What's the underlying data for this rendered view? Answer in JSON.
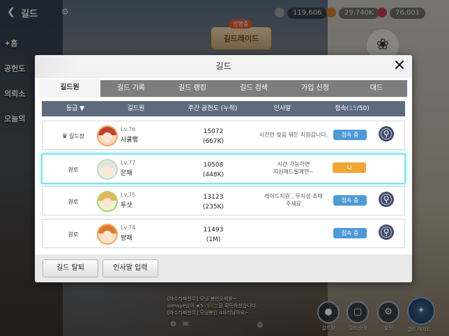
{
  "topbar": {
    "back_icon": "chevron-left-icon",
    "title": "길드",
    "currencies": [
      {
        "icon": "stamina-icon",
        "value": "119,606"
      },
      {
        "icon": "gold-icon",
        "value": "29,740K"
      },
      {
        "icon": "gem-icon",
        "value": "76,001"
      }
    ]
  },
  "side_nav": {
    "items": [
      "✦홈",
      "공헌도",
      "의뢰소",
      "오늘의"
    ]
  },
  "raid_banner": {
    "badge": "진행중",
    "label": "길드레이드"
  },
  "chat": {
    "lines": [
      {
        "prefix": "[아수라파천무]",
        "text": " 모닝 봉인오세요~"
      },
      {
        "prefix": "iomaye",
        "text": "님이 ★5 ",
        "em": "레이븐",
        "suffix": "을 획득하셨습니다."
      },
      {
        "prefix": "[아수라파천무]",
        "text": " 모닝봉인 4자리남아요~"
      }
    ]
  },
  "bottom_menu": [
    {
      "label": "길드원",
      "icon": "members-icon"
    },
    {
      "label": "길드 상점",
      "icon": "shop-icon"
    },
    {
      "label": "설정",
      "icon": "gear-icon"
    },
    {
      "label": "길드 아지트",
      "icon": "guild-hideout-icon"
    }
  ],
  "modal": {
    "title": "길드",
    "tabs": [
      "길드원",
      "길드 기록",
      "길드 랭킹",
      "길드 검색",
      "가입 신청",
      "대드"
    ],
    "active_tab": 0,
    "headers": {
      "grade": "등급 ▼",
      "member": "길드원",
      "contribution": "주간 공헌도 (누적)",
      "greeting": "인사말",
      "online_label": "접속(",
      "online_count": "15",
      "online_total": "/50)"
    },
    "members": [
      {
        "grade": "길드장",
        "crown": "♛",
        "level": "Lv.76",
        "name": "사쿨팽",
        "weekly": "15072",
        "total": "(667K)",
        "greeting_lines": [
          "시간만 맞음 뭐든 지원갑니다."
        ],
        "status": "접속 중",
        "is_self": false
      },
      {
        "grade": "원로",
        "crown": "",
        "level": "Lv.77",
        "name": "은채",
        "weekly": "10508",
        "total": "(448K)",
        "greeting_lines": [
          "시간 가능하면",
          "지원해드릴께연~"
        ],
        "status": "나",
        "is_self": true
      },
      {
        "grade": "원로",
        "crown": "",
        "level": "Lv.75",
        "name": "투샷",
        "weekly": "13123",
        "total": "(235K)",
        "greeting_lines": [
          "레이드지원 , 무지성 초대",
          "주세요"
        ],
        "status": "접속 중",
        "is_self": false
      },
      {
        "grade": "원로",
        "crown": "",
        "level": "Lv.74",
        "name": "방패",
        "weekly": "11493",
        "total": "(1M)",
        "greeting_lines": [
          ""
        ],
        "status": "접속 중",
        "is_self": false
      }
    ],
    "footer": {
      "leave_button": "길드 탈퇴",
      "greeting_button": "인사말 입력"
    }
  }
}
